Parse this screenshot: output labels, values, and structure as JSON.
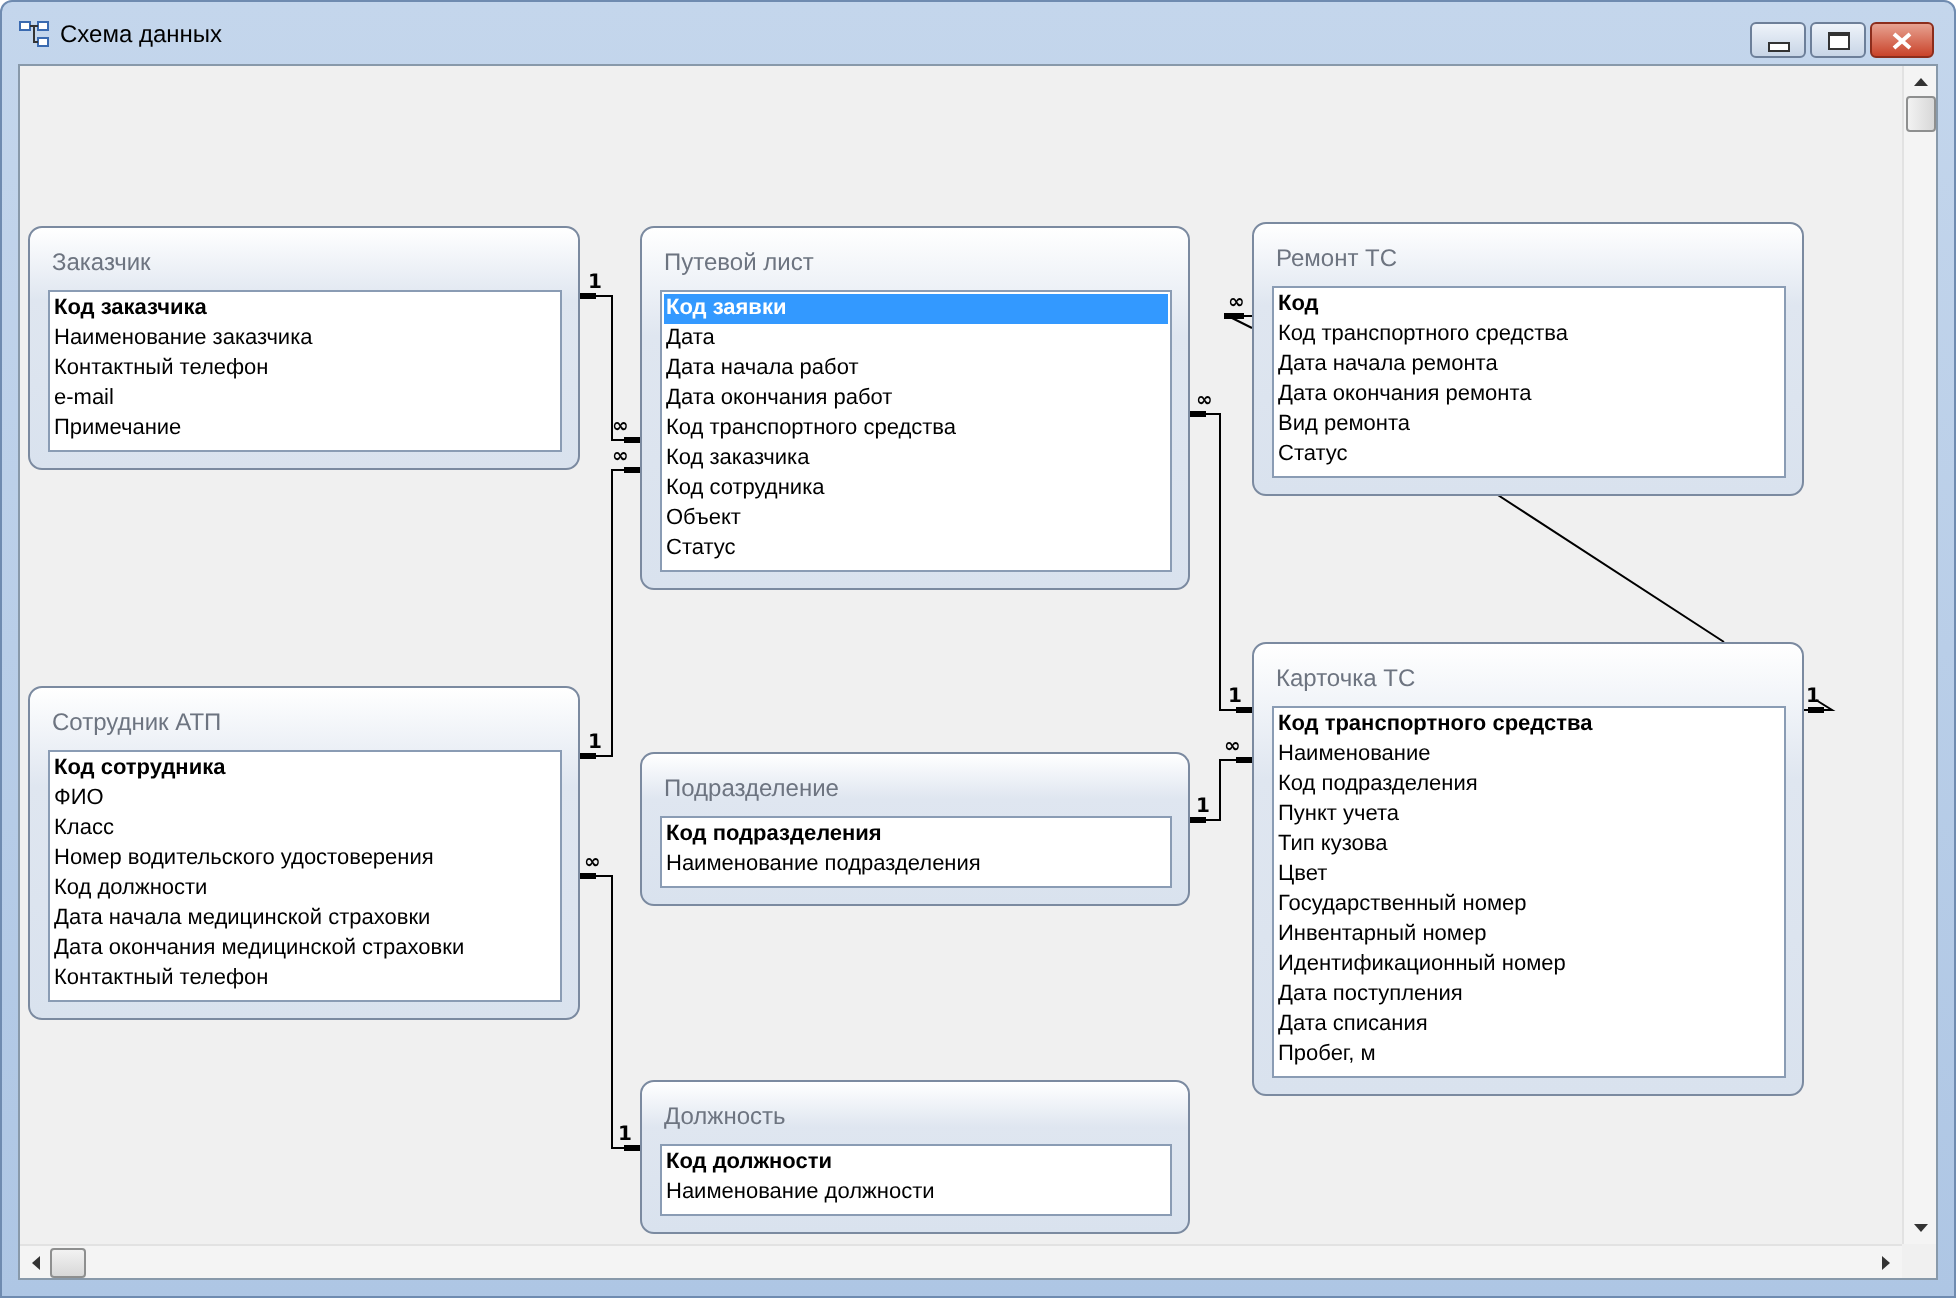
{
  "window": {
    "title": "Схема данных"
  },
  "tables": [
    {
      "title": "Заказчик",
      "fields": [
        {
          "name": "Код заказчика",
          "key": true,
          "selected": false
        },
        {
          "name": "Наименование заказчика",
          "key": false,
          "selected": false
        },
        {
          "name": "Контактный телефон",
          "key": false,
          "selected": false
        },
        {
          "name": "e-mail",
          "key": false,
          "selected": false
        },
        {
          "name": "Примечание",
          "key": false,
          "selected": false
        }
      ]
    },
    {
      "title": "Путевой лист",
      "fields": [
        {
          "name": "Код заявки",
          "key": true,
          "selected": true
        },
        {
          "name": "Дата",
          "key": false,
          "selected": false
        },
        {
          "name": "Дата начала работ",
          "key": false,
          "selected": false
        },
        {
          "name": "Дата окончания работ",
          "key": false,
          "selected": false
        },
        {
          "name": "Код транспортного средства",
          "key": false,
          "selected": false
        },
        {
          "name": "Код заказчика",
          "key": false,
          "selected": false
        },
        {
          "name": "Код сотрудника",
          "key": false,
          "selected": false
        },
        {
          "name": "Объект",
          "key": false,
          "selected": false
        },
        {
          "name": "Статус",
          "key": false,
          "selected": false
        }
      ]
    },
    {
      "title": "Ремонт ТС",
      "fields": [
        {
          "name": "Код",
          "key": true,
          "selected": false
        },
        {
          "name": "Код транспортного средства",
          "key": false,
          "selected": false
        },
        {
          "name": "Дата начала ремонта",
          "key": false,
          "selected": false
        },
        {
          "name": "Дата окончания ремонта",
          "key": false,
          "selected": false
        },
        {
          "name": "Вид ремонта",
          "key": false,
          "selected": false
        },
        {
          "name": "Статус",
          "key": false,
          "selected": false
        }
      ]
    },
    {
      "title": "Сотрудник АТП",
      "fields": [
        {
          "name": "Код сотрудника",
          "key": true,
          "selected": false
        },
        {
          "name": "ФИО",
          "key": false,
          "selected": false
        },
        {
          "name": "Класс",
          "key": false,
          "selected": false
        },
        {
          "name": "Номер водительского удостоверения",
          "key": false,
          "selected": false
        },
        {
          "name": "Код должности",
          "key": false,
          "selected": false
        },
        {
          "name": "Дата начала медицинской страховки",
          "key": false,
          "selected": false
        },
        {
          "name": "Дата окончания медицинской страховки",
          "key": false,
          "selected": false
        },
        {
          "name": "Контактный телефон",
          "key": false,
          "selected": false
        }
      ]
    },
    {
      "title": "Подразделение",
      "fields": [
        {
          "name": "Код подразделения",
          "key": true,
          "selected": false
        },
        {
          "name": "Наименование подразделения",
          "key": false,
          "selected": false
        }
      ]
    },
    {
      "title": "Карточка ТС",
      "fields": [
        {
          "name": "Код транспортного средства",
          "key": true,
          "selected": false
        },
        {
          "name": "Наименование",
          "key": false,
          "selected": false
        },
        {
          "name": "Код подразделения",
          "key": false,
          "selected": false
        },
        {
          "name": "Пункт учета",
          "key": false,
          "selected": false
        },
        {
          "name": "Тип кузова",
          "key": false,
          "selected": false
        },
        {
          "name": "Цвет",
          "key": false,
          "selected": false
        },
        {
          "name": "Государственный номер",
          "key": false,
          "selected": false
        },
        {
          "name": "Инвентарный номер",
          "key": false,
          "selected": false
        },
        {
          "name": "Идентификационный номер",
          "key": false,
          "selected": false
        },
        {
          "name": "Дата поступления",
          "key": false,
          "selected": false
        },
        {
          "name": "Дата списания",
          "key": false,
          "selected": false
        },
        {
          "name": "Пробег, м",
          "key": false,
          "selected": false
        }
      ]
    },
    {
      "title": "Должность",
      "fields": [
        {
          "name": "Код должности",
          "key": true,
          "selected": false
        },
        {
          "name": "Наименование должности",
          "key": false,
          "selected": false
        }
      ]
    }
  ],
  "relationships": [
    {
      "end_1": "1",
      "end_2": "∞"
    },
    {
      "end_1": "1",
      "end_2": "∞"
    },
    {
      "end_1": "∞",
      "end_2": "1"
    },
    {
      "end_1": "∞",
      "end_2": "1"
    },
    {
      "end_1": "1",
      "end_2": "∞"
    },
    {
      "end_1": "∞",
      "end_2": "1"
    }
  ]
}
